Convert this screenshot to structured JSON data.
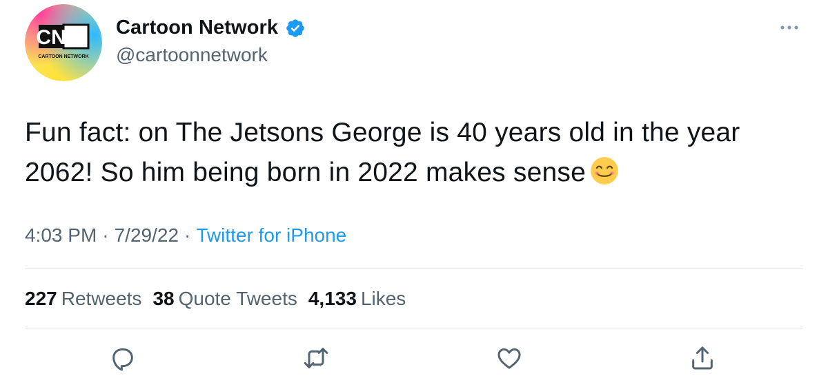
{
  "account": {
    "display_name": "Cartoon Network",
    "handle": "@cartoonnetwork",
    "verified": true,
    "avatar_logo_text": "CN",
    "avatar_logo_subtext": "CARTOON NETWORK"
  },
  "tweet": {
    "text": "Fun fact: on The Jetsons George is 40 years old in the year 2062! So him being born in 2022 makes sense",
    "emoji": "smiling-face-icon",
    "time": "4:03 PM",
    "date": "7/29/22",
    "separator": "·",
    "source": "Twitter for iPhone"
  },
  "stats": {
    "retweets": {
      "count": "227",
      "label": "Retweets"
    },
    "quote_tweets": {
      "count": "38",
      "label": "Quote Tweets"
    },
    "likes": {
      "count": "4,133",
      "label": "Likes"
    }
  },
  "actions": {
    "reply": "reply-icon",
    "retweet": "retweet-icon",
    "like": "heart-icon",
    "share": "share-icon"
  },
  "colors": {
    "text_primary": "#0f1419",
    "text_secondary": "#536471",
    "accent": "#1d9bf0",
    "divider": "#dfe3e6"
  }
}
